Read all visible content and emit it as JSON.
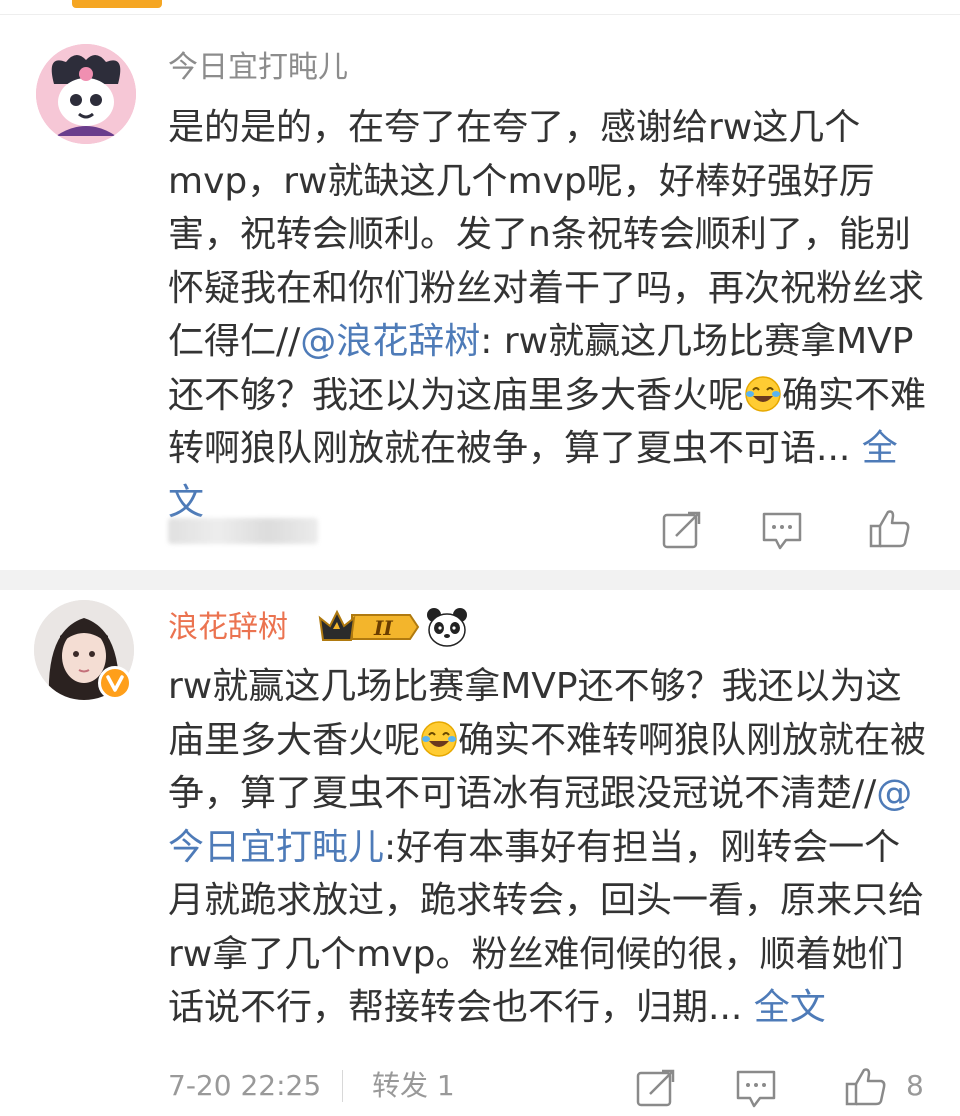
{
  "comments": [
    {
      "username": "今日宜打盹儿",
      "text_part1": "是的是的，在夸了在夸了，感谢给rw这几个mvp，rw就缺这几个mvp呢，好棒好强好厉害，祝转会顺利。发了n条祝转会顺利了，能别怀疑我在和你们粉丝对着干了吗，再次祝粉丝求仁得仁//",
      "mention": "@浪花辞树",
      "text_part2": ": rw就赢这几场比赛拿MVP还不够？我还以为这庙里多大香火呢",
      "text_part3": "确实不难转啊狼队刚放就在被争，算了夏虫不可语...",
      "full_text_link": "全文"
    },
    {
      "username": "浪花辞树",
      "badge_level": "II",
      "text_part1": "rw就赢这几场比赛拿MVP还不够？我还以为这庙里多大香火呢",
      "text_part2": "确实不难转啊狼队刚放就在被争，算了夏虫不可语冰有冠跟没冠说不清楚//",
      "mention": "@今日宜打盹儿",
      "text_part3": ":好有本事好有担当，刚转会一个月就跪求放过，跪求转会，回头一看，原来只给rw拿了几个mvp。粉丝难伺候的很，顺着她们话说不行，帮接转会也不行，归期...",
      "full_text_link": "全文",
      "time": "7-20 22:25",
      "repost_label": "转发 1",
      "like_count": "8"
    }
  ],
  "icons": {
    "repost": "repost-icon",
    "comment": "comment-icon",
    "like": "thumbs-up-icon",
    "emoji": "laughing-tears-emoji",
    "badge": "crown-vip-badge-icon",
    "panda": "panda-icon",
    "verified": "verified-v-icon"
  },
  "colors": {
    "username_plain": "#8c8c8c",
    "username_vip": "#eb7350",
    "link": "#4e7bb8",
    "text": "#333333",
    "muted": "#999999"
  }
}
